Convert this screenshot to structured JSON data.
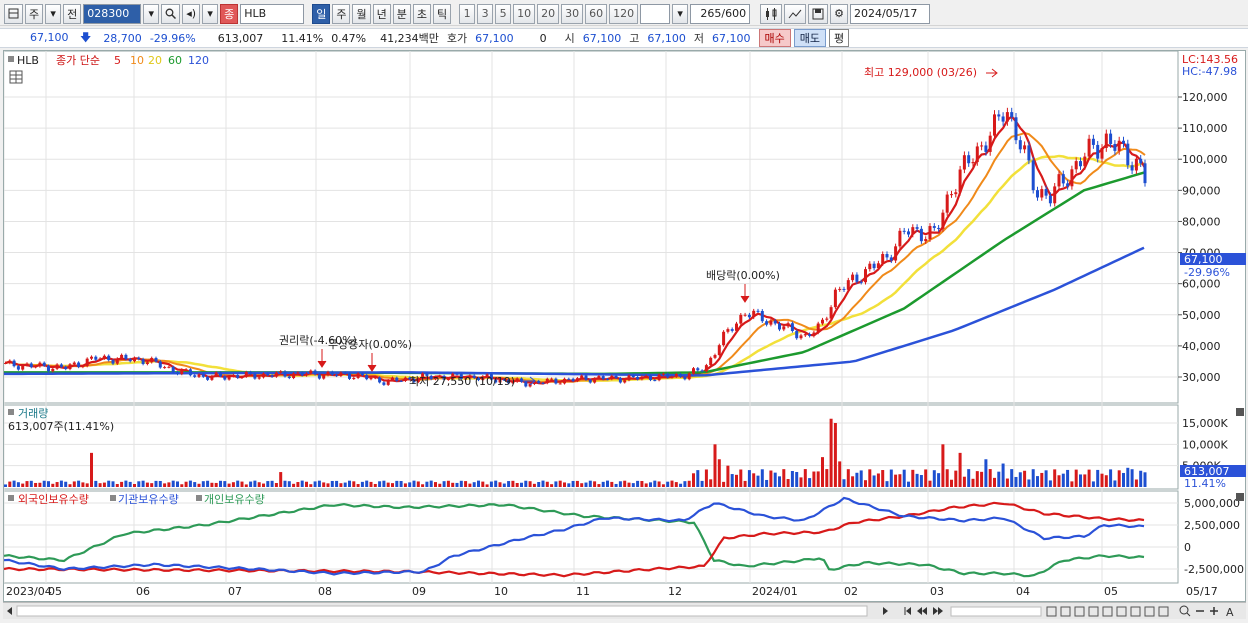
{
  "toolbar": {
    "btn_ju": "주",
    "btn_jeon": "전",
    "code": "028300",
    "name_tag": "종",
    "stock_name": "HLB",
    "periods": [
      "일",
      "주",
      "월",
      "년",
      "분",
      "초",
      "틱"
    ],
    "ticks": [
      "1",
      "3",
      "5",
      "10",
      "20",
      "30",
      "60",
      "120"
    ],
    "count": "265",
    "count_total": "/600",
    "date": "2024/05/17"
  },
  "quote": {
    "price": "67,100",
    "change": "28,700",
    "change_pct": "-29.96%",
    "volume": "613,007",
    "vol_ratio": "11.41%",
    "turnover": "0.47%",
    "amount": "41,234백만",
    "bid_label": "호가",
    "bid": "67,100",
    "bid_qty": "0",
    "open_label": "시",
    "open": "67,100",
    "high_label": "고",
    "high": "67,100",
    "low_label": "저",
    "low": "67,100",
    "buy": "매수",
    "sell": "매도",
    "eval": "평"
  },
  "price_panel": {
    "name": "HLB",
    "legend_prefix": "종가 단순",
    "ma_labels": [
      "5",
      "10",
      "20",
      "60",
      "120"
    ],
    "lc": "LC:143.56",
    "hc": "HC:-47.98",
    "y_labels": [
      "120,000",
      "110,000",
      "100,000",
      "90,000",
      "80,000",
      "70,000",
      "60,000",
      "50,000",
      "40,000",
      "30,000"
    ],
    "current_price": "67,100",
    "current_pct": "-29.96%",
    "high_annotation": "최고 129,000 (03/26)",
    "low_annotation": "최저 27,550 (10/19)",
    "dividend_annotation": "배당락(0.00%)",
    "rights_annotation": "권리락(-4.60%)",
    "bonus_annotation": "무상증자(0.00%)"
  },
  "volume_panel": {
    "title": "거래량",
    "value_label": "613,007주(11.41%)",
    "y_labels": [
      "15,000K",
      "10,000K",
      "5,000K"
    ],
    "current": "613,007",
    "current_pct": "11.41%"
  },
  "holding_panel": {
    "legend": [
      "외국인보유수량",
      "기관보유수량",
      "개인보유수량"
    ],
    "y_labels": [
      "5,000,000",
      "2,500,000",
      "0",
      "-2,500,000"
    ]
  },
  "x_axis": [
    "2023/04",
    "05",
    "06",
    "07",
    "08",
    "09",
    "10",
    "11",
    "12",
    "2024/01",
    "02",
    "03",
    "04",
    "05",
    "05/17"
  ],
  "colors": {
    "ma5": "#d71a1a",
    "ma10": "#f08a1a",
    "ma20": "#f2e03a",
    "ma60": "#1c9a2e",
    "ma120": "#2b52d8",
    "up": "#d71a1a",
    "down": "#1d4fd0",
    "foreign": "#d71a1a",
    "institution": "#2b52d8",
    "individual": "#2e9a57"
  },
  "chart_data": {
    "type": "line",
    "title": "",
    "x": [
      "2023/04",
      "05",
      "06",
      "07",
      "08",
      "09",
      "10",
      "11",
      "12",
      "2024/01",
      "02",
      "03",
      "04",
      "05"
    ],
    "series": [
      {
        "name": "5",
        "values": [
          34000,
          35000,
          33000,
          30000,
          31000,
          29000,
          29500,
          30000,
          34000,
          50000,
          68000,
          105000,
          95000,
          92000
        ]
      },
      {
        "name": "120",
        "values": [
          32000,
          32500,
          32500,
          32000,
          32000,
          31500,
          31000,
          31000,
          31000,
          33000,
          40000,
          52000,
          62000,
          72000
        ]
      }
    ],
    "ylim": [
      25000,
      143560
    ],
    "xlabel": "",
    "ylabel": ""
  }
}
